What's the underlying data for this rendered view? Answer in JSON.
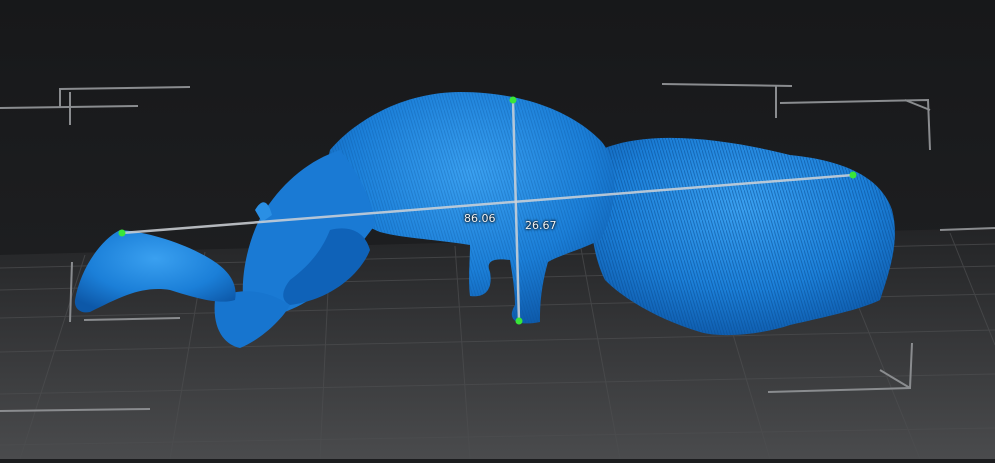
{
  "viewport": {
    "background_color": "#1b1c1e",
    "grid_color": "#4a4b4d",
    "model_color": "#1877d0",
    "model_highlight_color": "#3aa0f0",
    "measurement_line_color": "#cfd3d8",
    "measurement_point_color": "#39e639"
  },
  "model": {
    "subject": "anteater"
  },
  "measurements": {
    "length": {
      "value": "86.06",
      "icon": "measurement-line"
    },
    "height": {
      "value": "26.67",
      "icon": "measurement-line"
    }
  }
}
